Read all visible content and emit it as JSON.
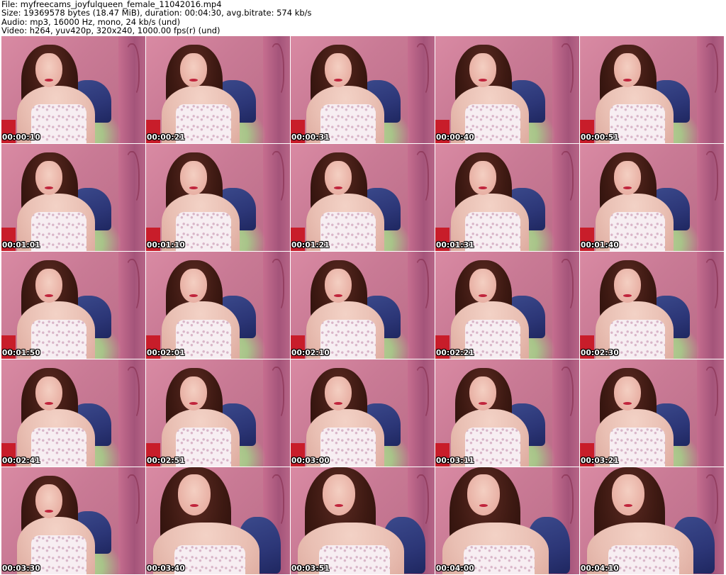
{
  "header": {
    "file_line": "File: myfreecams_joyfulqueen_female_11042016.mp4",
    "size_line": "Size: 19369578 bytes (18.47 MiB), duration: 00:04:30, avg.bitrate: 574 kb/s",
    "audio_line": "Audio: mp3, 16000 Hz, mono, 24 kb/s (und)",
    "video_line": "Video: h264, yuv420p, 320x240, 1000.00 fps(r) (und)"
  },
  "thumbnails": [
    {
      "timestamp": "00:00:10",
      "shot": "mid"
    },
    {
      "timestamp": "00:00:21",
      "shot": "mid"
    },
    {
      "timestamp": "00:00:31",
      "shot": "mid"
    },
    {
      "timestamp": "00:00:40",
      "shot": "mid"
    },
    {
      "timestamp": "00:00:51",
      "shot": "mid"
    },
    {
      "timestamp": "00:01:01",
      "shot": "mid"
    },
    {
      "timestamp": "00:01:10",
      "shot": "mid"
    },
    {
      "timestamp": "00:01:21",
      "shot": "mid"
    },
    {
      "timestamp": "00:01:31",
      "shot": "mid"
    },
    {
      "timestamp": "00:01:40",
      "shot": "mid"
    },
    {
      "timestamp": "00:01:50",
      "shot": "mid"
    },
    {
      "timestamp": "00:02:01",
      "shot": "mid"
    },
    {
      "timestamp": "00:02:10",
      "shot": "mid"
    },
    {
      "timestamp": "00:02:21",
      "shot": "mid"
    },
    {
      "timestamp": "00:02:30",
      "shot": "mid"
    },
    {
      "timestamp": "00:02:41",
      "shot": "mid"
    },
    {
      "timestamp": "00:02:51",
      "shot": "mid"
    },
    {
      "timestamp": "00:03:00",
      "shot": "mid"
    },
    {
      "timestamp": "00:03:11",
      "shot": "mid"
    },
    {
      "timestamp": "00:03:21",
      "shot": "mid"
    },
    {
      "timestamp": "00:03:30",
      "shot": "mid"
    },
    {
      "timestamp": "00:03:40",
      "shot": "close"
    },
    {
      "timestamp": "00:03:51",
      "shot": "close"
    },
    {
      "timestamp": "00:04:00",
      "shot": "close"
    },
    {
      "timestamp": "00:04:10",
      "shot": "close"
    }
  ]
}
